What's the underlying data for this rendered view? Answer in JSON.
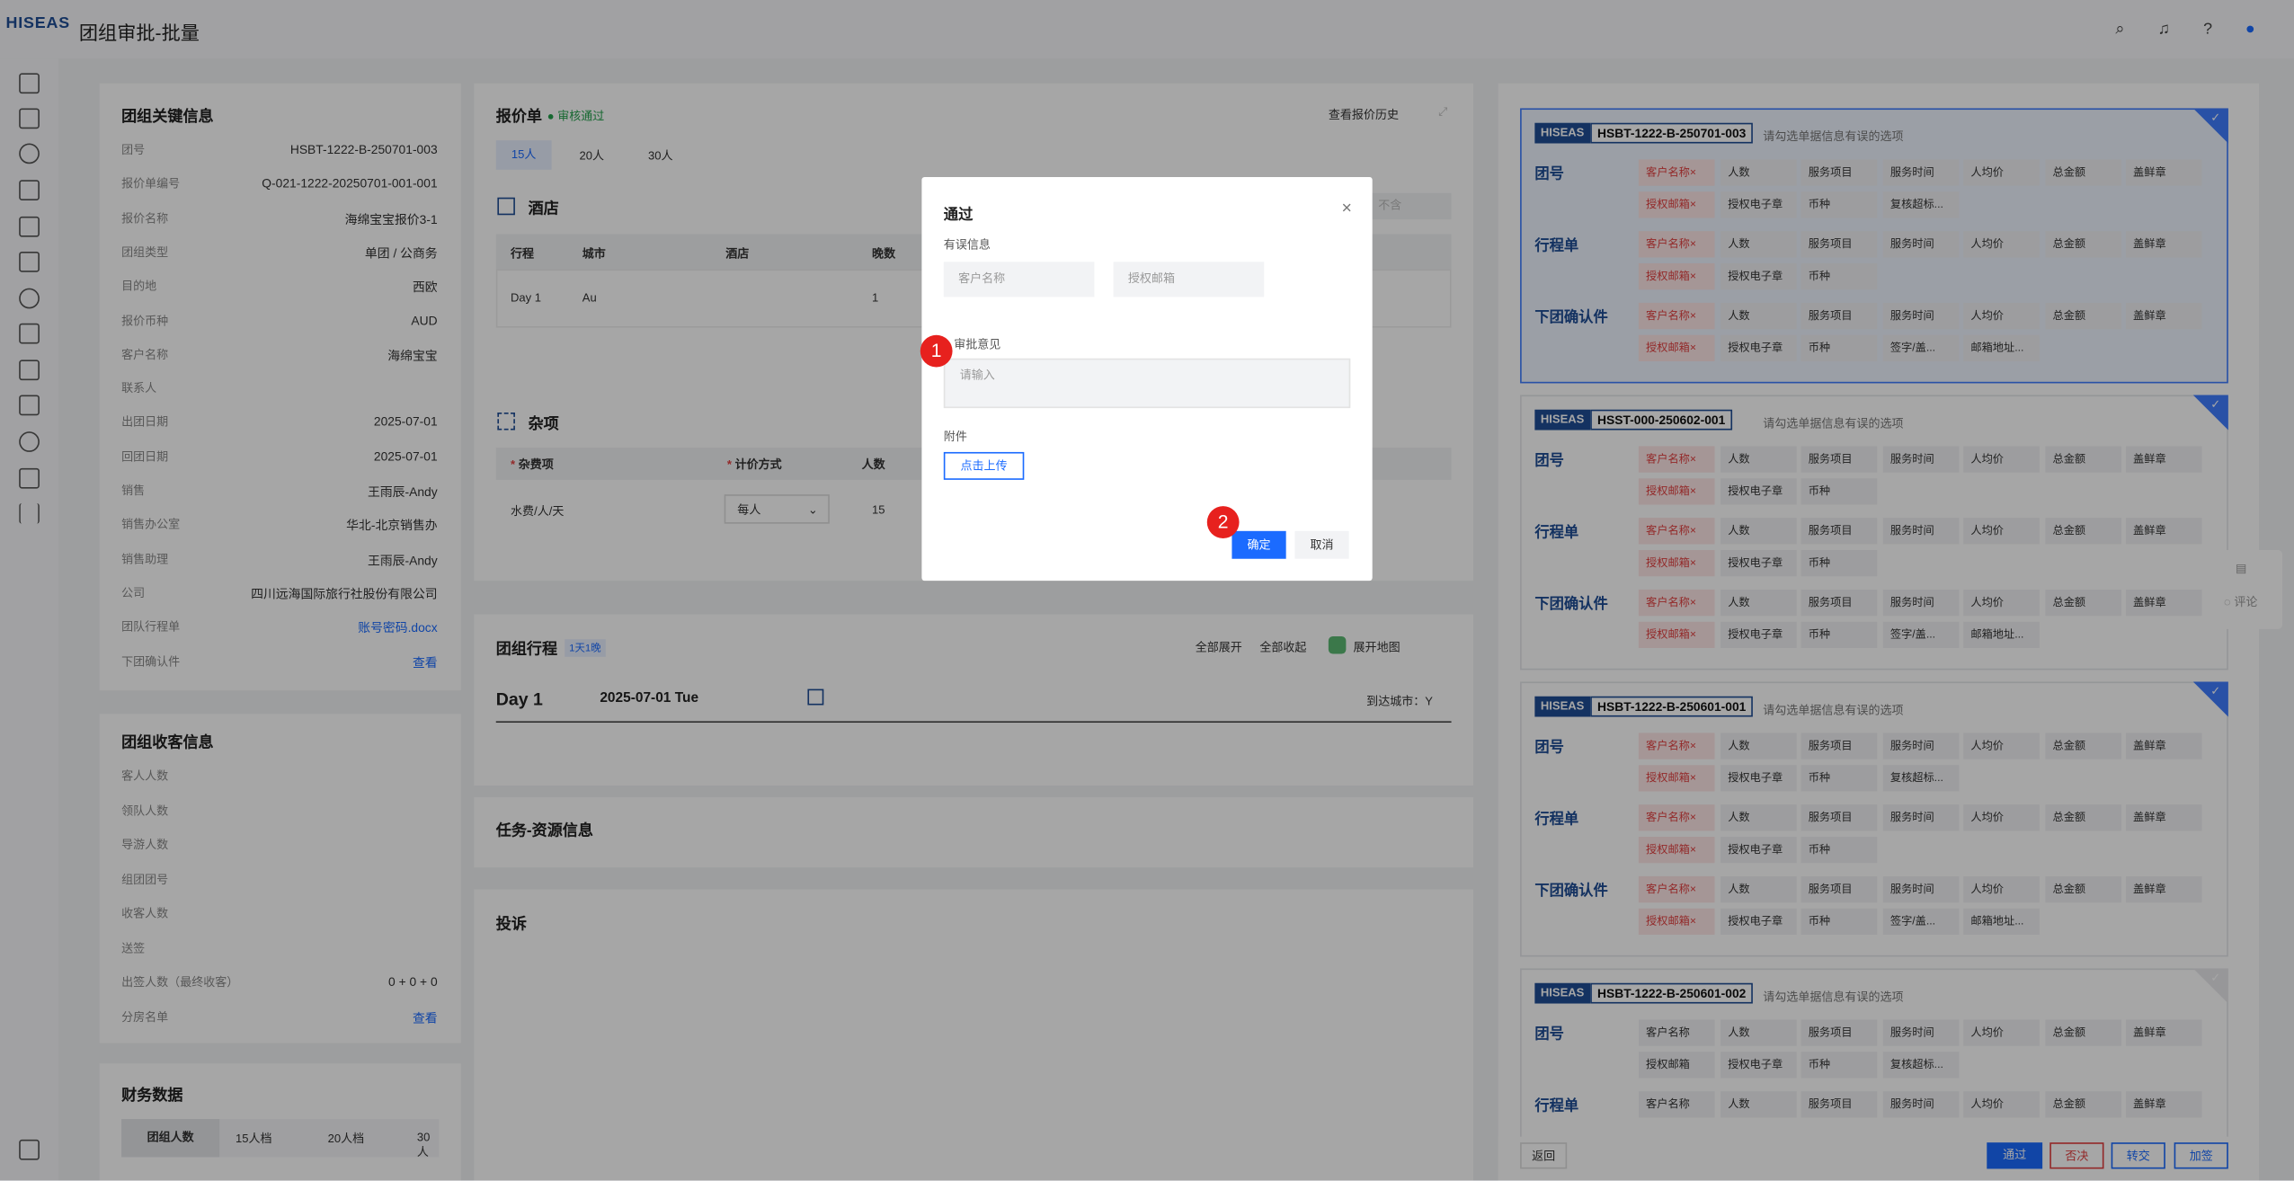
{
  "app": {
    "logo": "HISEAS",
    "title": "团组审批-批量"
  },
  "header_icons": [
    "search-icon",
    "bell-icon",
    "help-icon",
    "user-icon"
  ],
  "key_info": {
    "title": "团组关键信息",
    "rows": [
      {
        "k": "团号",
        "v": "HSBT-1222-B-250701-003"
      },
      {
        "k": "报价单编号",
        "v": "Q-021-1222-20250701-001-001"
      },
      {
        "k": "报价名称",
        "v": "海绵宝宝报价3-1"
      },
      {
        "k": "团组类型",
        "v": "单团 / 公商务"
      },
      {
        "k": "目的地",
        "v": "西欧"
      },
      {
        "k": "报价币种",
        "v": "AUD"
      },
      {
        "k": "客户名称",
        "v": "海绵宝宝"
      },
      {
        "k": "联系人",
        "v": ""
      },
      {
        "k": "出团日期",
        "v": "2025-07-01"
      },
      {
        "k": "回团日期",
        "v": "2025-07-01"
      },
      {
        "k": "销售",
        "v": "王雨辰-Andy"
      },
      {
        "k": "销售办公室",
        "v": "华北-北京销售办"
      },
      {
        "k": "销售助理",
        "v": "王雨辰-Andy"
      },
      {
        "k": "公司",
        "v": "四川远海国际旅行社股份有限公司"
      },
      {
        "k": "团队行程单",
        "v": "账号密码.docx"
      },
      {
        "k": "下团确认件",
        "v": "查看"
      }
    ]
  },
  "guest_info": {
    "title": "团组收客信息",
    "rows": [
      {
        "k": "客人人数",
        "v": ""
      },
      {
        "k": "领队人数",
        "v": ""
      },
      {
        "k": "导游人数",
        "v": ""
      },
      {
        "k": "组团团号",
        "v": ""
      },
      {
        "k": "收客人数",
        "v": ""
      },
      {
        "k": "送签",
        "v": ""
      },
      {
        "k": "出签人数（最终收客）",
        "v": "0 + 0 + 0"
      },
      {
        "k": "分房名单",
        "v": "查看"
      }
    ]
  },
  "finance": {
    "title": "财务数据",
    "tabs": [
      "团组人数",
      "15人档",
      "20人档",
      "30人"
    ]
  },
  "quote": {
    "title": "报价单",
    "status": "审核通过",
    "history": "查看报价历史",
    "tabs": [
      "15人",
      "20人",
      "30人"
    ],
    "hotel": {
      "title": "酒店",
      "cols": [
        "行程",
        "城市",
        "酒店",
        "晚数"
      ],
      "row": [
        "Day 1",
        "Au",
        "",
        "1"
      ],
      "placeholder": "不含"
    },
    "misc": {
      "title": "杂项",
      "cols": [
        "杂费项",
        "计价方式",
        "人数"
      ],
      "row": [
        "水费/人/天",
        "每人",
        "15"
      ]
    }
  },
  "itinerary": {
    "title": "团组行程",
    "badge": "1天1晚",
    "expand_all": "全部展开",
    "collapse_all": "全部收起",
    "map": "展开地图",
    "day": "Day 1",
    "date": "2025-07-01 Tue",
    "arrive": "到达城市：Y"
  },
  "task": {
    "title": "任务-资源信息"
  },
  "complaint": {
    "title": "投诉"
  },
  "right_panel": {
    "hint": "请勾选单据信息有误的选项",
    "brand": "HISEAS",
    "cards": [
      {
        "code": "HSBT-1222-B-250701-003",
        "selected": true,
        "checked": true,
        "sections": [
          {
            "label": "团号",
            "r1": [
              "客户名称×",
              "人数",
              "服务项目",
              "服务时间",
              "人均价",
              "总金额",
              "盖鲜章"
            ],
            "r2": [
              "授权邮箱×",
              "授权电子章",
              "币种",
              "复核超标..."
            ]
          },
          {
            "label": "行程单",
            "r1": [
              "客户名称×",
              "人数",
              "服务项目",
              "服务时间",
              "人均价",
              "总金额",
              "盖鲜章"
            ],
            "r2": [
              "授权邮箱×",
              "授权电子章",
              "币种"
            ]
          },
          {
            "label": "下团确认件",
            "r1": [
              "客户名称×",
              "人数",
              "服务项目",
              "服务时间",
              "人均价",
              "总金额",
              "盖鲜章"
            ],
            "r2": [
              "授权邮箱×",
              "授权电子章",
              "币种",
              "签字/盖...",
              "邮箱地址..."
            ]
          }
        ]
      },
      {
        "code": "HSST-000-250602-001",
        "selected": false,
        "checked": true,
        "sections": [
          {
            "label": "团号",
            "r1": [
              "客户名称×",
              "人数",
              "服务项目",
              "服务时间",
              "人均价",
              "总金额",
              "盖鲜章"
            ],
            "r2": [
              "授权邮箱×",
              "授权电子章",
              "币种"
            ]
          },
          {
            "label": "行程单",
            "r1": [
              "客户名称×",
              "人数",
              "服务项目",
              "服务时间",
              "人均价",
              "总金额",
              "盖鲜章"
            ],
            "r2": [
              "授权邮箱×",
              "授权电子章",
              "币种"
            ]
          },
          {
            "label": "下团确认件",
            "r1": [
              "客户名称×",
              "人数",
              "服务项目",
              "服务时间",
              "人均价",
              "总金额",
              "盖鲜章"
            ],
            "r2": [
              "授权邮箱×",
              "授权电子章",
              "币种",
              "签字/盖...",
              "邮箱地址..."
            ]
          }
        ]
      },
      {
        "code": "HSBT-1222-B-250601-001",
        "selected": false,
        "checked": true,
        "sections": [
          {
            "label": "团号",
            "r1": [
              "客户名称×",
              "人数",
              "服务项目",
              "服务时间",
              "人均价",
              "总金额",
              "盖鲜章"
            ],
            "r2": [
              "授权邮箱×",
              "授权电子章",
              "币种",
              "复核超标..."
            ]
          },
          {
            "label": "行程单",
            "r1": [
              "客户名称×",
              "人数",
              "服务项目",
              "服务时间",
              "人均价",
              "总金额",
              "盖鲜章"
            ],
            "r2": [
              "授权邮箱×",
              "授权电子章",
              "币种"
            ]
          },
          {
            "label": "下团确认件",
            "r1": [
              "客户名称×",
              "人数",
              "服务项目",
              "服务时间",
              "人均价",
              "总金额",
              "盖鲜章"
            ],
            "r2": [
              "授权邮箱×",
              "授权电子章",
              "币种",
              "签字/盖...",
              "邮箱地址..."
            ]
          }
        ]
      },
      {
        "code": "HSBT-1222-B-250601-002",
        "selected": false,
        "checked": false,
        "sections": [
          {
            "label": "团号",
            "r1": [
              "客户名称",
              "人数",
              "服务项目",
              "服务时间",
              "人均价",
              "总金额",
              "盖鲜章"
            ],
            "r2": [
              "授权邮箱",
              "授权电子章",
              "币种",
              "复核超标..."
            ]
          },
          {
            "label": "行程单",
            "r1": [
              "客户名称",
              "人数",
              "服务项目",
              "服务时间",
              "人均价",
              "总金额",
              "盖鲜章"
            ],
            "r2": []
          }
        ]
      }
    ]
  },
  "floating": {
    "comment": "评论"
  },
  "bottom": {
    "back": "返回",
    "pass": "通过",
    "reject": "否决",
    "transfer": "转交",
    "add_sign": "加签"
  },
  "dialog": {
    "title": "通过",
    "error_info": "有误信息",
    "customer_ph": "客户名称",
    "email_ph": "授权邮箱",
    "opinion_label": "审批意见",
    "opinion_ph": "请输入",
    "attach_label": "附件",
    "upload": "点击上传",
    "ok": "确定",
    "cancel": "取消",
    "steps": [
      "1",
      "2"
    ]
  }
}
